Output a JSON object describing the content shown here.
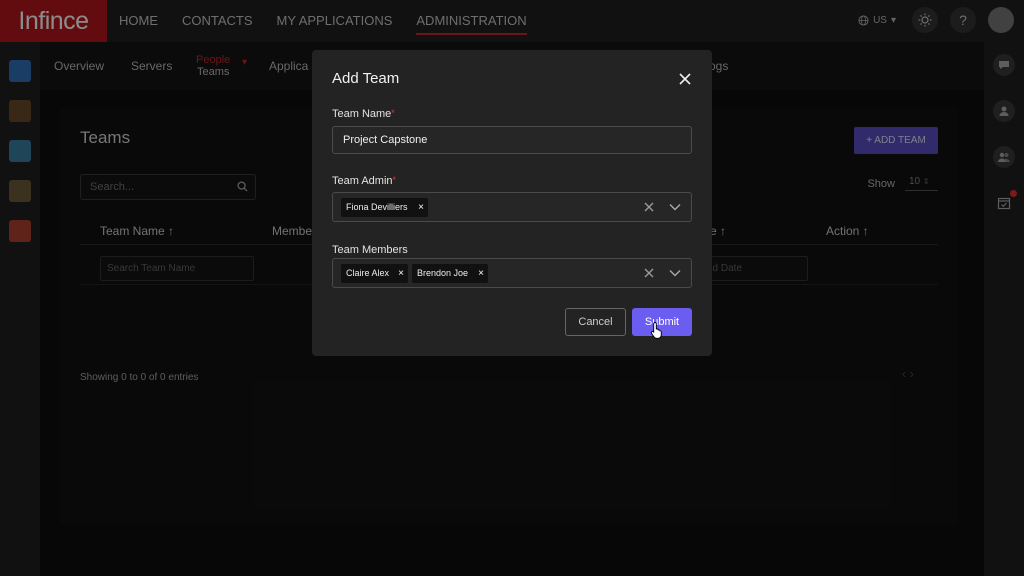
{
  "app": {
    "logo_text": "Infince"
  },
  "topnav": {
    "items": [
      "HOME",
      "CONTACTS",
      "MY APPLICATIONS",
      "ADMINISTRATION"
    ],
    "active": "ADMINISTRATION"
  },
  "header": {
    "language": "US"
  },
  "subnav": {
    "overview": "Overview",
    "servers": "Servers",
    "people": "People",
    "teams": "Teams",
    "applications_partial": "Applica",
    "logs_partial": "ogs"
  },
  "page": {
    "title": "Teams",
    "add_button": "+ ADD TEAM",
    "search_placeholder": "Search...",
    "show_label": "Show",
    "show_value": "10",
    "columns": {
      "team_name": "Team Name ↑",
      "members_partial": "Membe",
      "date_partial": "e ↑",
      "action": "Action ↑"
    },
    "filters": {
      "team_name_placeholder": "Search Team Name",
      "date_placeholder_partial": "ed Date"
    },
    "showing_text": "Showing 0 to 0 of 0 entries",
    "pager": "‹  ›"
  },
  "modal": {
    "title": "Add Team",
    "team_name_label": "Team Name",
    "team_name_value": "Project Capstone",
    "team_admin_label": "Team Admin",
    "team_admin_chips": [
      "Fiona Devilliers"
    ],
    "team_members_label": "Team Members",
    "team_members_chips": [
      "Claire Alex",
      "Brendon Joe"
    ],
    "required_mark": "*",
    "chip_remove": "×",
    "cancel_label": "Cancel",
    "submit_label": "Submit"
  },
  "colors": {
    "brand_red": "#b3171e",
    "accent_purple": "#6b5df0",
    "add_button": "#5a4fc4"
  },
  "icons": [
    "globe-icon",
    "sun-icon",
    "help-icon",
    "close-icon",
    "search-icon",
    "chevron-down-icon",
    "chat-icon",
    "user-icon",
    "users-icon",
    "calendar-check-icon",
    "cursor-hand-icon"
  ]
}
